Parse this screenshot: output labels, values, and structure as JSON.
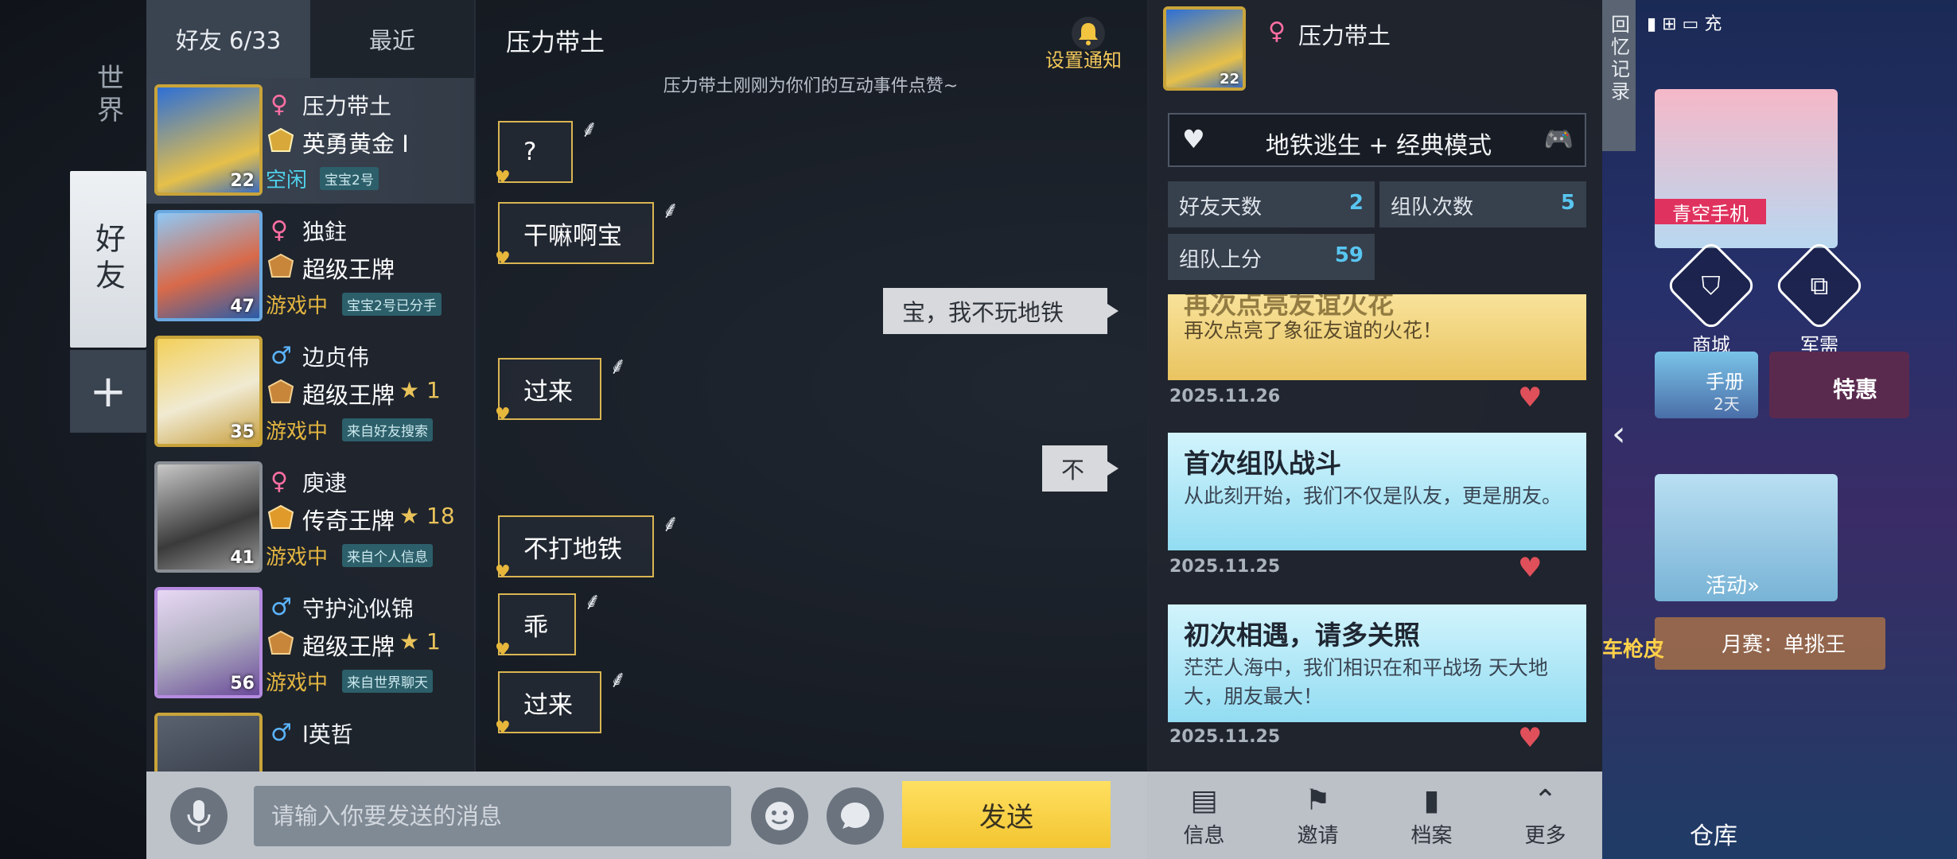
{
  "rail": {
    "world": "世界",
    "friends": "好友",
    "add": "+"
  },
  "friend_list": {
    "tab_friends": "好友 6/33",
    "tab_recent": "最近",
    "friends": [
      {
        "name": "压力带土",
        "gender": "♀",
        "rank": "英勇黄金 I",
        "level": "22",
        "status": "空闲",
        "tag": "宝宝2号",
        "stars": ""
      },
      {
        "name": "独鉒",
        "gender": "♀",
        "rank": "超级王牌",
        "level": "47",
        "status": "游戏中",
        "tag": "宝宝2号已分手",
        "stars": ""
      },
      {
        "name": "边贞伟",
        "gender": "♂",
        "rank": "超级王牌",
        "level": "35",
        "status": "游戏中",
        "tag": "来自好友搜索",
        "stars": "★ 1"
      },
      {
        "name": "庾逮",
        "gender": "♀",
        "rank": "传奇王牌",
        "level": "41",
        "status": "游戏中",
        "tag": "来自个人信息",
        "stars": "★ 18"
      },
      {
        "name": "守护沁似锦",
        "gender": "♂",
        "rank": "超级王牌",
        "level": "56",
        "status": "游戏中",
        "tag": "来自世界聊天",
        "stars": "★ 1"
      },
      {
        "name": "l英哲",
        "gender": "♂",
        "rank": "",
        "level": "",
        "status": "",
        "tag": "",
        "stars": ""
      }
    ]
  },
  "chat": {
    "title": "压力带土",
    "notify_label": "设置通知",
    "system_message": "压力带土刚刚为你们的互动事件点赞~",
    "messages_in": [
      "?",
      "干嘛啊宝",
      "过来",
      "不打地铁",
      "乖",
      "过来"
    ],
    "messages_out": [
      "宝，我不玩地铁",
      "不"
    ]
  },
  "input": {
    "placeholder": "请输入你要发送的消息",
    "send": "发送"
  },
  "profile": {
    "name": "压力带土",
    "gender": "♀",
    "avatar_level": "22",
    "mode": "地铁逃生 + 经典模式",
    "stats": [
      {
        "label": "好友天数",
        "value": "2"
      },
      {
        "label": "组队次数",
        "value": "5"
      },
      {
        "label": "组队上分",
        "value": "59"
      }
    ],
    "events": [
      {
        "title": "再次点亮友谊火花",
        "desc": "再次点亮了象征友谊的火花！",
        "date": "2025.11.26"
      },
      {
        "title": "首次组队战斗",
        "desc": "从此刻开始，我们不仅是队友，更是朋友。",
        "date": "2025.11.25"
      },
      {
        "title": "初次相遇，请多关照",
        "desc": "茫茫人海中，我们相识在和平战场 天大地大，朋友最大！",
        "date": "2025.11.25"
      }
    ],
    "bottom": [
      "信息",
      "邀请",
      "档案",
      "更多"
    ]
  },
  "lobby": {
    "memory_tab": "回忆记录",
    "status_text": "充",
    "promo": "青空手机",
    "shop": "商城",
    "supply": "军需",
    "manual": "手册",
    "manual_days": "2天",
    "offer": "特惠",
    "activity": "活动»",
    "match": "月赛：单挑王",
    "gun_skin": "车枪皮",
    "warehouse": "仓库"
  },
  "colors": {
    "gold": "#f3c530",
    "card_gold": "#f5d77a",
    "card_blue": "#a9e8f8",
    "idle": "#4fd0e8",
    "ingame": "#e3b540"
  }
}
